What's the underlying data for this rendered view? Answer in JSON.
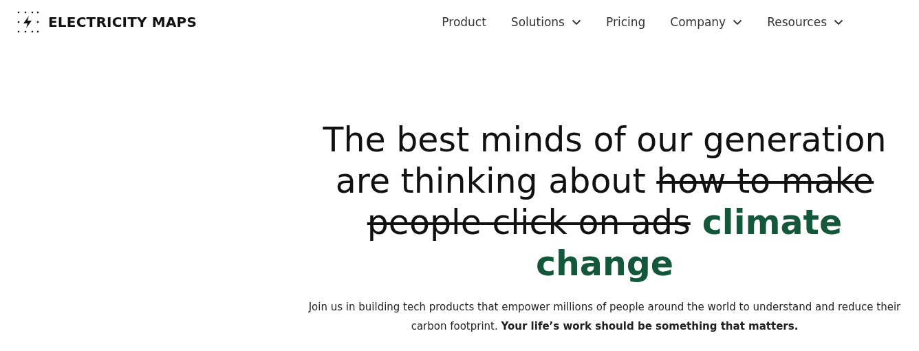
{
  "logo": {
    "text": "ELECTRICITY MAPS"
  },
  "nav": [
    {
      "label": "Product",
      "dropdown": false
    },
    {
      "label": "Solutions",
      "dropdown": true
    },
    {
      "label": "Pricing",
      "dropdown": false
    },
    {
      "label": "Company",
      "dropdown": true
    },
    {
      "label": "Resources",
      "dropdown": true
    }
  ],
  "headline": [
    {
      "kind": "plain",
      "text": "The best minds of our generation are thinking about "
    },
    {
      "kind": "struck",
      "text": "how to make people click on ads"
    },
    {
      "kind": "highlight",
      "text": " climate change"
    }
  ],
  "intro": "Join us in building tech products that empower millions of people around the world to understand and reduce their carbon footprint. **Your life’s work should be something that matters.**"
}
